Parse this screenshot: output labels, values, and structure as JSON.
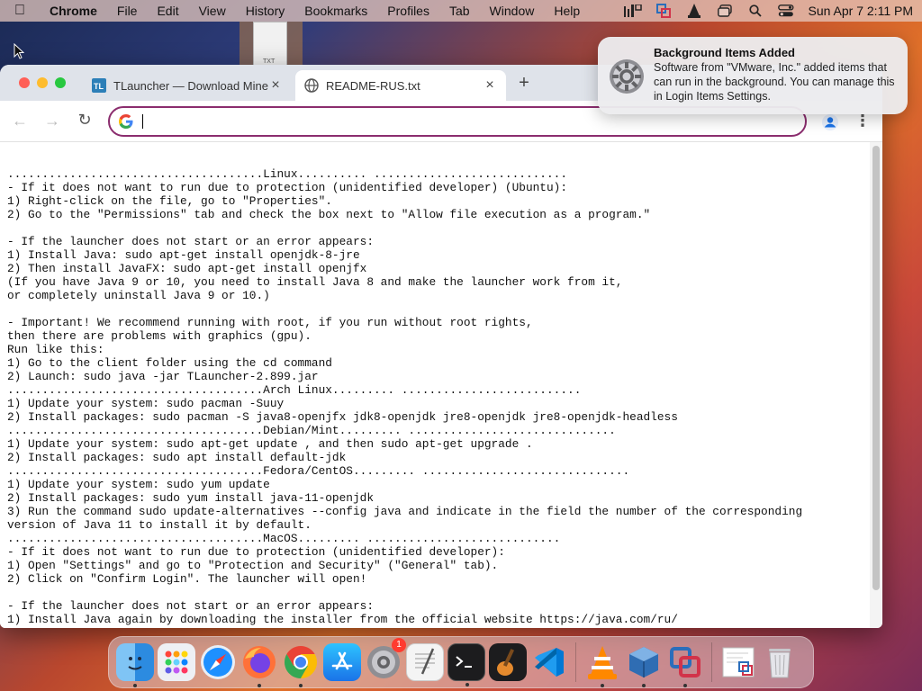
{
  "menubar": {
    "app_name": "Chrome",
    "items": [
      "File",
      "Edit",
      "View",
      "History",
      "Bookmarks",
      "Profiles",
      "Tab",
      "Window",
      "Help"
    ],
    "clock": "Sun Apr 7  2:11 PM"
  },
  "desktop": {
    "file_label": "TXT"
  },
  "browser": {
    "tabs": [
      {
        "title": "TLauncher — Download Minecraft",
        "favicon": "tlauncher-icon",
        "favicon_text": "TL"
      },
      {
        "title": "README-RUS.txt",
        "favicon": "globe-icon"
      }
    ],
    "omnibox": {
      "value": "",
      "placeholder": ""
    },
    "content_lines": [
      ".....................................Linux.......... ............................",
      "- If it does not want to run due to protection (unidentified developer) (Ubuntu):",
      "1) Right-click on the file, go to \"Properties\".",
      "2) Go to the \"Permissions\" tab and check the box next to \"Allow file execution as a program.\"",
      "",
      "- If the launcher does not start or an error appears:",
      "1) Install Java: sudo apt-get install openjdk-8-jre",
      "2) Then install JavaFX: sudo apt-get install openjfx",
      "(If you have Java 9 or 10, you need to install Java 8 and make the launcher work from it,",
      "or completely uninstall Java 9 or 10.)",
      "",
      "- Important! We recommend running with root, if you run without root rights,",
      "then there are problems with graphics (gpu).",
      "Run like this:",
      "1) Go to the client folder using the cd command",
      "2) Launch: sudo java -jar TLauncher-2.899.jar",
      ".....................................Arch Linux......... ..........................",
      "1) Update your system: sudo pacman -Suuy",
      "2) Install packages: sudo pacman -S java8-openjfx jdk8-openjdk jre8-openjdk jre8-openjdk-headless",
      ".....................................Debian/Mint......... ..............................",
      "1) Update your system: sudo apt-get update , and then sudo apt-get upgrade .",
      "2) Install packages: sudo apt install default-jdk",
      ".....................................Fedora/CentOS......... ..............................",
      "1) Update your system: sudo yum update",
      "2) Install packages: sudo yum install java-11-openjdk",
      "3) Run the command sudo update-alternatives --config java and indicate in the field the number of the corresponding",
      "version of Java 11 to install it by default.",
      ".....................................MacOS......... ............................",
      "- If it does not want to run due to protection (unidentified developer):",
      "1) Open \"Settings\" and go to \"Protection and Security\" (\"General\" tab).",
      "2) Click on \"Confirm Login\". The launcher will open!",
      "",
      "- If the launcher does not start or an error appears:",
      "1) Install Java again by downloading the installer from the official website https://java.com/ru/"
    ]
  },
  "notification": {
    "title": "Background Items Added",
    "body": "Software from \"VMware, Inc.\" added items that can run in the background. You can manage this in Login Items Settings."
  },
  "dock": {
    "items": [
      {
        "name": "finder-icon",
        "running": true
      },
      {
        "name": "launchpad-icon",
        "running": false
      },
      {
        "name": "safari-icon",
        "running": false
      },
      {
        "name": "firefox-icon",
        "running": true
      },
      {
        "name": "chrome-icon",
        "running": true
      },
      {
        "name": "app-store-icon",
        "running": false
      },
      {
        "name": "system-settings-icon",
        "running": false,
        "badge": "1"
      },
      {
        "name": "textedit-icon",
        "running": false
      },
      {
        "name": "terminal-icon",
        "running": true
      },
      {
        "name": "garageband-icon",
        "running": false
      },
      {
        "name": "vscode-icon",
        "running": false
      },
      {
        "name": "vlc-icon",
        "running": true
      },
      {
        "name": "virtualbox-icon",
        "running": true
      },
      {
        "name": "vmware-fusion-icon",
        "running": true
      },
      {
        "name": "downloads-stack-icon",
        "running": false
      },
      {
        "name": "trash-icon",
        "running": false
      }
    ]
  },
  "colors": {
    "omnibox_border": "#8b2d6e",
    "close_red": "#ff5f57",
    "minimize_yellow": "#febc2e",
    "zoom_green": "#28c840"
  }
}
